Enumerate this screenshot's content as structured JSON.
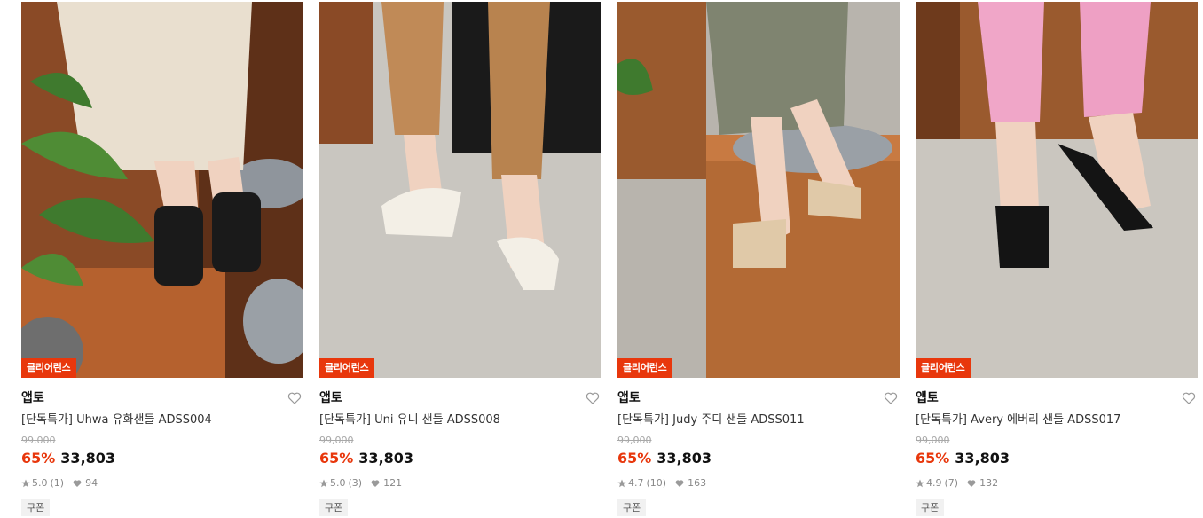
{
  "products": [
    {
      "badge": "클리어런스",
      "brand": "앱토",
      "name": "[단독특가] Uhwa 유화샌들 ADSS004",
      "original_price": "99,000",
      "discount": "65%",
      "price": "33,803",
      "rating": "5.0",
      "review_count": "(1)",
      "likes": "94",
      "coupon": "쿠폰",
      "icons": {
        "rating": "star-icon",
        "likes": "heart-icon",
        "wish": "heart-outline-icon"
      }
    },
    {
      "badge": "클리어런스",
      "brand": "앱토",
      "name": "[단독특가] Uni 유니 샌들 ADSS008",
      "original_price": "99,000",
      "discount": "65%",
      "price": "33,803",
      "rating": "5.0",
      "review_count": "(3)",
      "likes": "121",
      "coupon": "쿠폰",
      "icons": {
        "rating": "star-icon",
        "likes": "heart-icon",
        "wish": "heart-outline-icon"
      }
    },
    {
      "badge": "클리어런스",
      "brand": "앱토",
      "name": "[단독특가] Judy 주디 샌들 ADSS011",
      "original_price": "99,000",
      "discount": "65%",
      "price": "33,803",
      "rating": "4.7",
      "review_count": "(10)",
      "likes": "163",
      "coupon": "쿠폰",
      "icons": {
        "rating": "star-icon",
        "likes": "heart-icon",
        "wish": "heart-outline-icon"
      }
    },
    {
      "badge": "클리어런스",
      "brand": "앱토",
      "name": "[단독특가] Avery 에버리 샌들 ADSS017",
      "original_price": "99,000",
      "discount": "65%",
      "price": "33,803",
      "rating": "4.9",
      "review_count": "(7)",
      "likes": "132",
      "coupon": "쿠폰",
      "icons": {
        "rating": "star-icon",
        "likes": "heart-icon",
        "wish": "heart-outline-icon"
      }
    }
  ],
  "colors": {
    "accent": "#e8370c",
    "text": "#111111",
    "muted": "#888888"
  }
}
